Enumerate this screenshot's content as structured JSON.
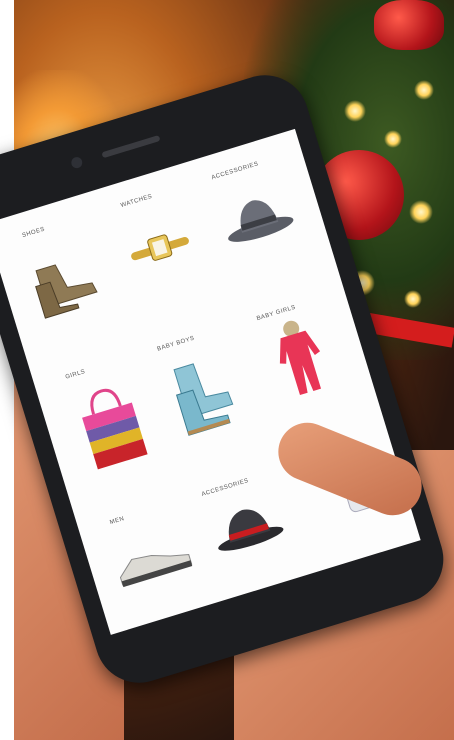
{
  "categories": {
    "row1": [
      "SHOES",
      "WATCHES",
      "ACCESSORIES"
    ],
    "row2": [
      "GIRLS",
      "BABY BOYS",
      "BABY GIRLS"
    ],
    "row3": [
      "MEN",
      "ACCESSORIES"
    ]
  },
  "products": {
    "row1": [
      "boot-icon",
      "watch-icon",
      "hat-icon"
    ],
    "row2": [
      "handbag-icon",
      "kids-boots-icon",
      "snowsuit-icon"
    ],
    "row3": [
      "sneaker-icon",
      "fedora-icon",
      "suitcase-icon"
    ]
  },
  "colors": {
    "background_fire": "#f2a64a",
    "ornament_red": "#c41a1e",
    "tree_green": "#2e4a1c"
  }
}
